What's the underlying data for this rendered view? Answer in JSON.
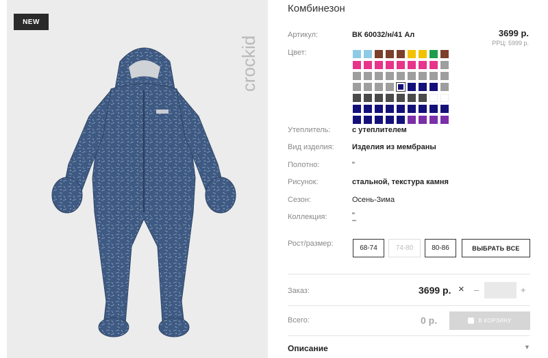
{
  "badge": "NEW",
  "brand": "crockid",
  "title": "Комбинезон",
  "labels": {
    "article": "Артикул:",
    "color": "Цвет:",
    "insulation": "Утеплитель:",
    "kind": "Вид изделия:",
    "fabric": "Полотно:",
    "pattern": "Рисунок:",
    "season": "Сезон:",
    "collection": "Коллекция:",
    "size": "Рост/размер:",
    "order": "Заказ:",
    "total": "Всего:"
  },
  "values": {
    "article": "ВК 60032/н/41 Ал",
    "insulation": "с утеплителем",
    "kind": "Изделия из мембраны",
    "fabric": "\"",
    "pattern": "стальной, текстура камня",
    "season": "Осень-Зима",
    "collection": "\"",
    "collection2": "–"
  },
  "price": "3699 р.",
  "rrp": "РРЦ: 5999 р.",
  "colors": [
    [
      "#8ecae6",
      "#8ecae6",
      "#7b3f2a",
      "#7b3f2a",
      "#7b3f2a",
      "#f2c200",
      "#f2c200",
      "#1e9e4a",
      "#7b3f2a"
    ],
    [
      "#e8338a",
      "#e8338a",
      "#e8338a",
      "#e8338a",
      "#e8338a",
      "#e8338a",
      "#e8338a",
      "#e8338a",
      "#9e9e9e"
    ],
    [
      "#9e9e9e",
      "#9e9e9e",
      "#9e9e9e",
      "#9e9e9e",
      "#9e9e9e",
      "#9e9e9e",
      "#9e9e9e",
      "#9e9e9e",
      "#9e9e9e"
    ],
    [
      "#9e9e9e",
      "#9e9e9e",
      "#9e9e9e",
      "#9e9e9e",
      "#14107a",
      "#14107a",
      "#14107a",
      "#14107a",
      "#9e9e9e"
    ],
    [
      "#4a4a4a",
      "#4a4a4a",
      "#4a4a4a",
      "#4a4a4a",
      "#4a4a4a",
      "#4a4a4a",
      "#4a4a4a",
      "empty",
      "empty"
    ],
    [
      "#14107a",
      "#14107a",
      "#14107a",
      "#14107a",
      "#14107a",
      "#14107a",
      "#14107a",
      "#14107a",
      "#14107a"
    ],
    [
      "#14107a",
      "#14107a",
      "#14107a",
      "#14107a",
      "#14107a",
      "#7b2fa8",
      "#7b2fa8",
      "#7b2fa8",
      "#7b2fa8"
    ]
  ],
  "selected_color": "row 3, column 5",
  "sizes": [
    {
      "label": "68-74",
      "available": true
    },
    {
      "label": "74-80",
      "available": false
    },
    {
      "label": "80-86",
      "available": true
    }
  ],
  "select_all": "ВЫБРАТЬ ВСЕ",
  "order": {
    "price": "3699 р.",
    "times": "×",
    "minus": "–",
    "qty": "",
    "plus": "+"
  },
  "total": "0 р.",
  "cart_button": "В КОРЗИНУ",
  "description": "Описание",
  "description_arrow": "▼",
  "product_color": "#3f5a82"
}
